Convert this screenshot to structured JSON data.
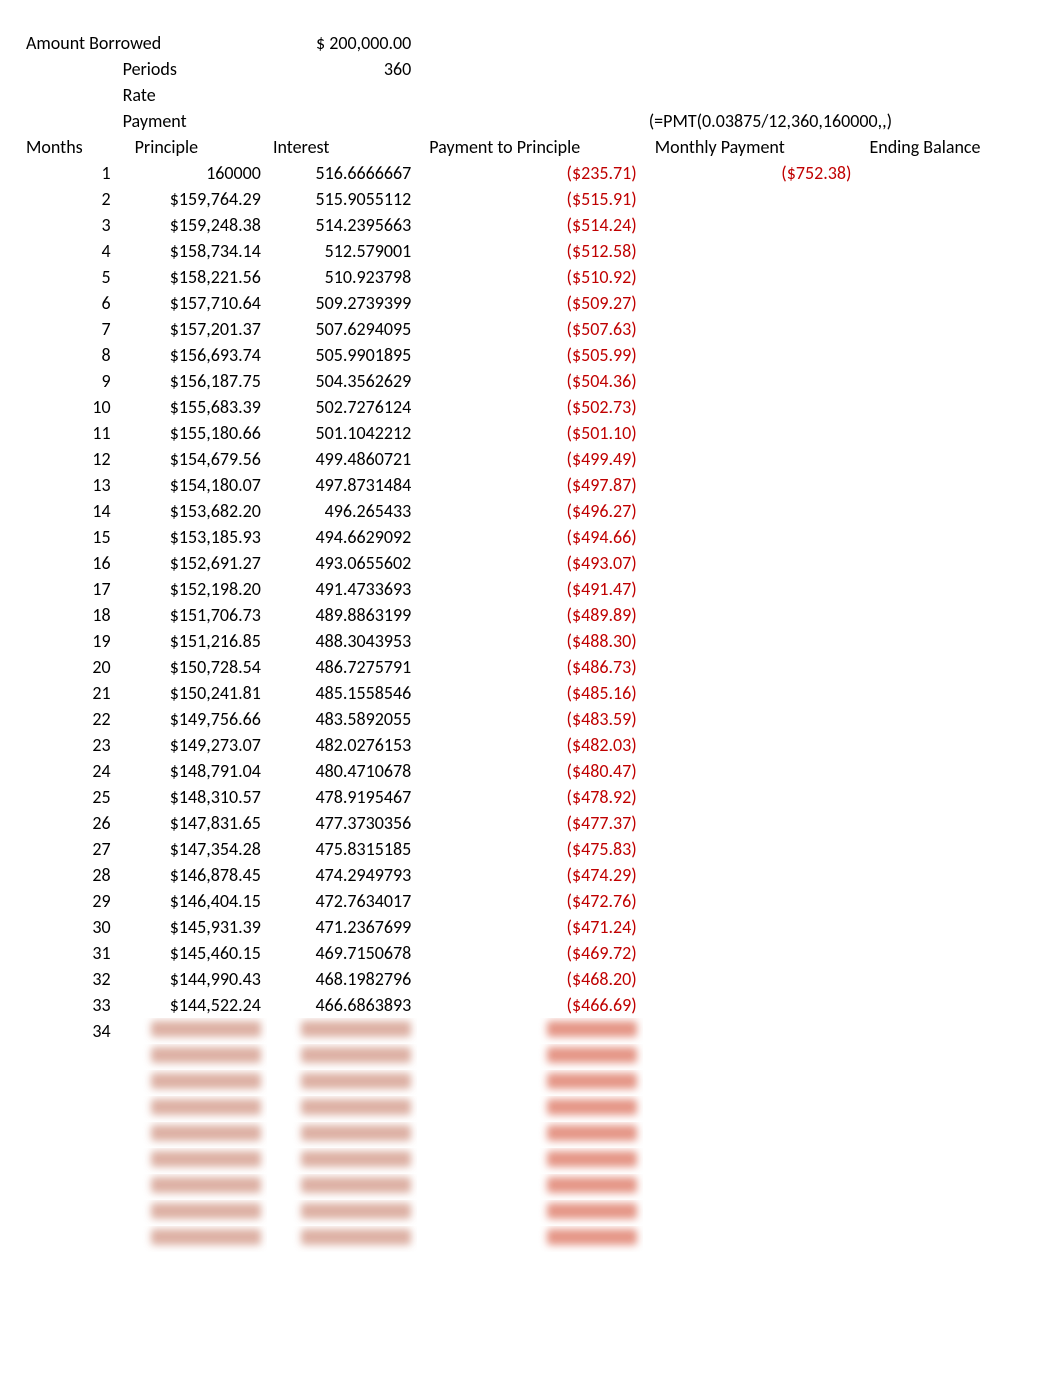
{
  "header": {
    "amountBorrowedLabel": "Amount Borrowed",
    "amountBorrowedValue": "$ 200,000.00",
    "periodsLabel": "Periods",
    "periodsValue": "360",
    "rateLabel": "Rate",
    "paymentLabel": "Payment",
    "pmtFormula": "(=PMT(0.03875/12,360,160000,,)"
  },
  "columns": {
    "months": "Months",
    "principle": "Principle",
    "interest": "Interest",
    "paymentToPrinciple": "Payment to Principle",
    "monthlyPayment": "Monthly Payment",
    "endingBalance": "Ending Balance"
  },
  "rows": [
    {
      "m": "1",
      "principle": "160000",
      "interest": "516.6666667",
      "ptp": "($235.71)",
      "mp": "($752.38)"
    },
    {
      "m": "2",
      "principle": "$159,764.29",
      "interest": "515.9055112",
      "ptp": "($515.91)"
    },
    {
      "m": "3",
      "principle": "$159,248.38",
      "interest": "514.2395663",
      "ptp": "($514.24)"
    },
    {
      "m": "4",
      "principle": "$158,734.14",
      "interest": "512.579001",
      "ptp": "($512.58)"
    },
    {
      "m": "5",
      "principle": "$158,221.56",
      "interest": "510.923798",
      "ptp": "($510.92)"
    },
    {
      "m": "6",
      "principle": "$157,710.64",
      "interest": "509.2739399",
      "ptp": "($509.27)"
    },
    {
      "m": "7",
      "principle": "$157,201.37",
      "interest": "507.6294095",
      "ptp": "($507.63)"
    },
    {
      "m": "8",
      "principle": "$156,693.74",
      "interest": "505.9901895",
      "ptp": "($505.99)"
    },
    {
      "m": "9",
      "principle": "$156,187.75",
      "interest": "504.3562629",
      "ptp": "($504.36)"
    },
    {
      "m": "10",
      "principle": "$155,683.39",
      "interest": "502.7276124",
      "ptp": "($502.73)"
    },
    {
      "m": "11",
      "principle": "$155,180.66",
      "interest": "501.1042212",
      "ptp": "($501.10)"
    },
    {
      "m": "12",
      "principle": "$154,679.56",
      "interest": "499.4860721",
      "ptp": "($499.49)"
    },
    {
      "m": "13",
      "principle": "$154,180.07",
      "interest": "497.8731484",
      "ptp": "($497.87)"
    },
    {
      "m": "14",
      "principle": "$153,682.20",
      "interest": "496.265433",
      "ptp": "($496.27)"
    },
    {
      "m": "15",
      "principle": "$153,185.93",
      "interest": "494.6629092",
      "ptp": "($494.66)"
    },
    {
      "m": "16",
      "principle": "$152,691.27",
      "interest": "493.0655602",
      "ptp": "($493.07)"
    },
    {
      "m": "17",
      "principle": "$152,198.20",
      "interest": "491.4733693",
      "ptp": "($491.47)"
    },
    {
      "m": "18",
      "principle": "$151,706.73",
      "interest": "489.8863199",
      "ptp": "($489.89)"
    },
    {
      "m": "19",
      "principle": "$151,216.85",
      "interest": "488.3043953",
      "ptp": "($488.30)"
    },
    {
      "m": "20",
      "principle": "$150,728.54",
      "interest": "486.7275791",
      "ptp": "($486.73)"
    },
    {
      "m": "21",
      "principle": "$150,241.81",
      "interest": "485.1558546",
      "ptp": "($485.16)"
    },
    {
      "m": "22",
      "principle": "$149,756.66",
      "interest": "483.5892055",
      "ptp": "($483.59)"
    },
    {
      "m": "23",
      "principle": "$149,273.07",
      "interest": "482.0276153",
      "ptp": "($482.03)"
    },
    {
      "m": "24",
      "principle": "$148,791.04",
      "interest": "480.4710678",
      "ptp": "($480.47)"
    },
    {
      "m": "25",
      "principle": "$148,310.57",
      "interest": "478.9195467",
      "ptp": "($478.92)"
    },
    {
      "m": "26",
      "principle": "$147,831.65",
      "interest": "477.3730356",
      "ptp": "($477.37)"
    },
    {
      "m": "27",
      "principle": "$147,354.28",
      "interest": "475.8315185",
      "ptp": "($475.83)"
    },
    {
      "m": "28",
      "principle": "$146,878.45",
      "interest": "474.2949793",
      "ptp": "($474.29)"
    },
    {
      "m": "29",
      "principle": "$146,404.15",
      "interest": "472.7634017",
      "ptp": "($472.76)"
    },
    {
      "m": "30",
      "principle": "$145,931.39",
      "interest": "471.2367699",
      "ptp": "($471.24)"
    },
    {
      "m": "31",
      "principle": "$145,460.15",
      "interest": "469.7150678",
      "ptp": "($469.72)"
    },
    {
      "m": "32",
      "principle": "$144,990.43",
      "interest": "468.1982796",
      "ptp": "($468.20)"
    },
    {
      "m": "33",
      "principle": "$144,522.24",
      "interest": "466.6863893",
      "ptp": "($466.69)"
    }
  ],
  "partialRow": {
    "m": "34"
  },
  "blurredRowCount": 9
}
